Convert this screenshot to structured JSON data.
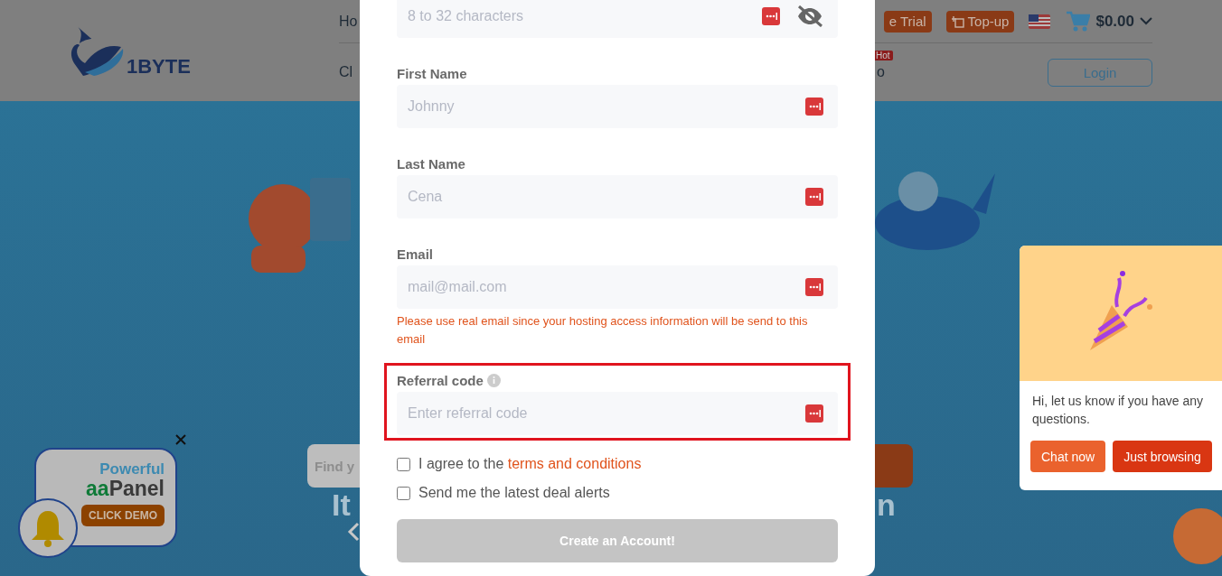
{
  "header": {
    "logo_text": "1BYTE",
    "nav_top": "Ho",
    "nav_bottom": "Cl",
    "nav_bottom_cut": "o",
    "hot_badge": "Hot",
    "trial_button": "e Trial",
    "topup_button": "Top-up",
    "cart_total": "$0.00",
    "login_button": "Login"
  },
  "hero": {
    "heading_left": "It",
    "heading_right": "n",
    "search": {
      "placeholder": "Find y"
    }
  },
  "promo": {
    "tagline": "Powerful",
    "brand_prefix": "aa",
    "brand_suffix": "Panel",
    "button": "CLICK DEMO"
  },
  "form": {
    "fields": [
      {
        "kind": "password",
        "placeholder": "8 to 32 characters",
        "highlighted": false
      },
      {
        "kind": "text",
        "label": "First Name",
        "placeholder": "Johnny",
        "highlighted": false
      },
      {
        "kind": "text",
        "label": "Last Name",
        "placeholder": "Cena",
        "highlighted": false
      },
      {
        "kind": "text",
        "label": "Email",
        "placeholder": "mail@mail.com",
        "note": "Please use real email since your hosting access information will be send to this email",
        "highlighted": false
      },
      {
        "kind": "info",
        "label": "Referral code",
        "placeholder": "Enter referral code",
        "highlighted": true
      }
    ],
    "checkboxes": [
      {
        "text": "I agree to the",
        "link": "terms and conditions",
        "checked": false
      },
      {
        "text": "Send me the latest deal alerts",
        "checked": false
      }
    ],
    "submit": {
      "label": "Create an Account!",
      "disabled": true
    }
  },
  "chat": {
    "message": "Hi, let us know if you have any questions.",
    "buttons": [
      {
        "label": "Chat now",
        "kind": "primary"
      },
      {
        "label": "Just browsing",
        "kind": "secondary"
      }
    ]
  }
}
